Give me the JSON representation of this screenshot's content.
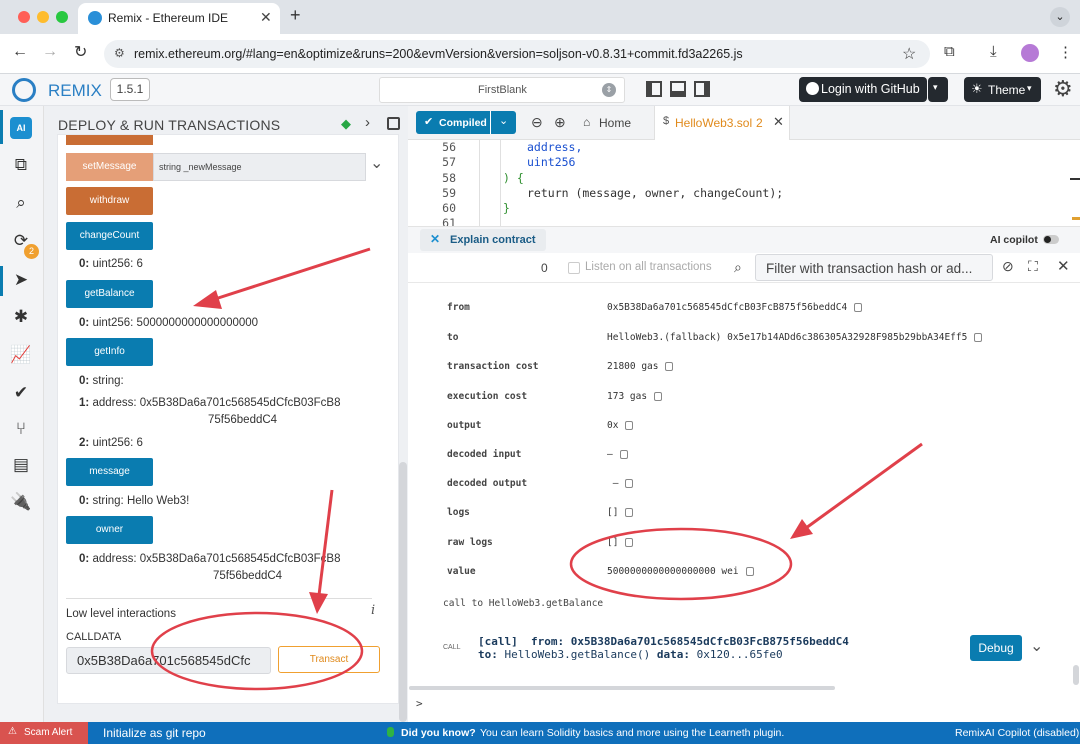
{
  "browser": {
    "tab_title": "Remix - Ethereum IDE",
    "new_tab": "+",
    "url": "remix.ethereum.org/#lang=en&optimize&runs=200&evmVersion&version=soljson-v0.8.31+commit.fd3a2265.js"
  },
  "topbar": {
    "logo_text": "REMIX",
    "version": "1.5.1",
    "workspace": "FirstBlank",
    "login_label": "Login with GitHub",
    "theme_label": "Theme"
  },
  "iconpanel": {
    "ai_badge": "AI",
    "compiler_badge": "2"
  },
  "sidepanel": {
    "title": "DEPLOY & RUN TRANSACTIONS",
    "setmessage_label": "setMessage",
    "setmessage_placeholder": "string _newMessage",
    "withdraw_label": "withdraw",
    "changecount_label": "changeCount",
    "changecount_out_idx": "0:",
    "changecount_out": "uint256: 6",
    "getbalance_label": "getBalance",
    "getbalance_out_idx": "0:",
    "getbalance_out": "uint256: 5000000000000000000",
    "getinfo_label": "getInfo",
    "getinfo_out": [
      {
        "idx": "0:",
        "text": "string:"
      },
      {
        "idx": "1:",
        "text": "address: 0x5B38Da6a701c568545dCfcB03FcB8"
      },
      {
        "idx": "",
        "text": "75f56beddC4"
      },
      {
        "idx": "2:",
        "text": "uint256: 6"
      }
    ],
    "message_label": "message",
    "message_out_idx": "0:",
    "message_out": "string: Hello Web3!",
    "owner_label": "owner",
    "owner_out_idx": "0:",
    "owner_out_1": "address: 0x5B38Da6a701c568545dCfcB03FcB8",
    "owner_out_2": "75f56beddC4",
    "low_level_title": "Low level interactions",
    "info_icon": "i",
    "calldata_label": "CALLDATA",
    "calldata_value": "0x5B38Da6a701c568545dCfc",
    "transact_label": "Transact"
  },
  "editor": {
    "compiled_label": "Compiled",
    "home_label": "Home",
    "file_tab": "HelloWeb3.sol",
    "file_tab_badge": "2",
    "lines": [
      {
        "n": "56",
        "text": "address,"
      },
      {
        "n": "57",
        "text": "uint256"
      },
      {
        "n": "58",
        "text": ") {"
      },
      {
        "n": "59",
        "text": "return (message, owner, changeCount);"
      },
      {
        "n": "60",
        "text": "}"
      },
      {
        "n": "61",
        "text": ""
      }
    ],
    "explain_label": "Explain contract",
    "ai_copilot_label": "AI copilot"
  },
  "terminal": {
    "pending_count": "0",
    "listen_label": "Listen on all transactions",
    "filter_placeholder": "Filter with transaction hash or ad...",
    "rows": [
      {
        "label": "from",
        "value": "0x5B38Da6a701c568545dCfcB03FcB875f56beddC4"
      },
      {
        "label": "to",
        "value": "HelloWeb3.(fallback) 0x5e17b14ADd6c386305A32928F985b29bbA34Eff5"
      },
      {
        "label": "transaction cost",
        "value": "21800 gas"
      },
      {
        "label": "execution cost",
        "value": "173 gas"
      },
      {
        "label": "output",
        "value": "0x"
      },
      {
        "label": "decoded input",
        "value": "–"
      },
      {
        "label": "decoded output",
        "value": " –"
      },
      {
        "label": "logs",
        "value": "[]"
      },
      {
        "label": "raw logs",
        "value": "[]"
      },
      {
        "label": "value",
        "value": "5000000000000000000 wei"
      }
    ],
    "call_note": "call to HelloWeb3.getBalance",
    "call_tag": "CALL",
    "call_line1": "[call]  from: 0x5B38Da6a701c568545dCfcB03FcB875f56beddC4",
    "call_line2_prefix": "to:",
    "call_line2": "HelloWeb3.getBalance()",
    "call_line2_data_label": "data:",
    "call_line2_data": "0x120...65fe0",
    "debug_label": "Debug",
    "prompt": ">"
  },
  "statusbar": {
    "scam_alert": "Scam Alert",
    "git_label": "Initialize as git repo",
    "did_you_know": "Did you know?",
    "tip": "You can learn Solidity basics and more using the Learneth plugin.",
    "copilot_status": "RemixAI Copilot (disabled)"
  },
  "colors": {
    "accent_blue": "#0a7cb0",
    "accent_orange": "#c96d34",
    "setmessage_orange": "#e59f78",
    "annotation_red": "#e0404a",
    "status_blue": "#0f6fbb"
  }
}
